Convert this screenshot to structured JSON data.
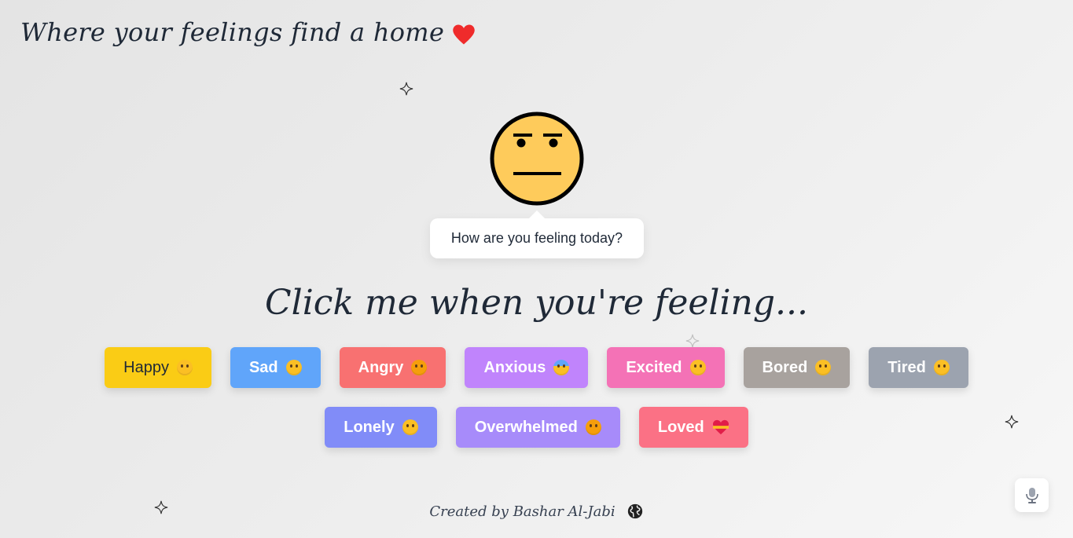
{
  "header": {
    "title": "Where your feelings find a home",
    "heart_icon": "heart-icon"
  },
  "mascot": {
    "face_icon": "neutral-face-icon",
    "bubble_text": "How are you feeling today?"
  },
  "prompt": {
    "title": "Click me when you're feeling..."
  },
  "moods": [
    {
      "label": "Happy",
      "color": "#facc15",
      "icon": "smiling-face-icon"
    },
    {
      "label": "Sad",
      "color": "#60a5fa",
      "icon": "sad-face-icon"
    },
    {
      "label": "Angry",
      "color": "#f87171",
      "icon": "angry-face-icon"
    },
    {
      "label": "Anxious",
      "color": "#c084fc",
      "icon": "anxious-face-icon"
    },
    {
      "label": "Excited",
      "color": "#f472b6",
      "icon": "star-eyes-face-icon"
    },
    {
      "label": "Bored",
      "color": "#a8a29e",
      "icon": "bored-face-icon"
    },
    {
      "label": "Tired",
      "color": "#9ca3af",
      "icon": "sleepy-face-icon"
    },
    {
      "label": "Lonely",
      "color": "#818cf8",
      "icon": "pleading-face-icon"
    },
    {
      "label": "Overwhelmed",
      "color": "#a78bfa",
      "icon": "overwhelmed-face-icon"
    },
    {
      "label": "Loved",
      "color": "#fb7185",
      "icon": "heart-ribbon-icon"
    }
  ],
  "footer": {
    "credit": "Created by Bashar Al-Jabi",
    "globe_icon": "globe-icon"
  },
  "mic": {
    "icon": "microphone-icon"
  }
}
